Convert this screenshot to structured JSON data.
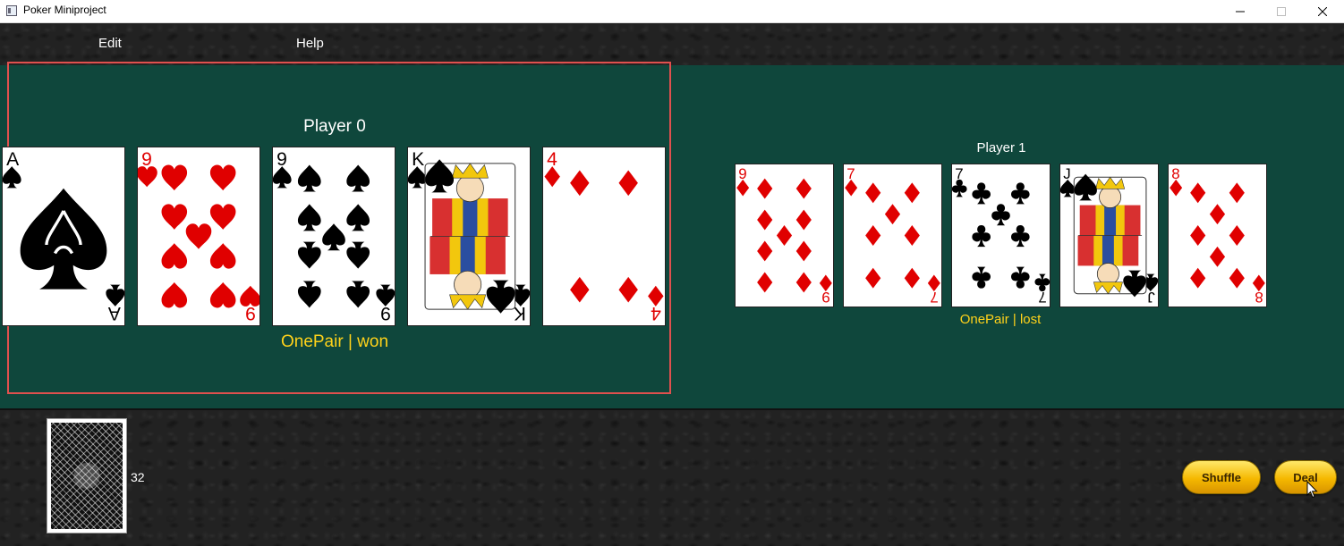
{
  "window": {
    "title": "Poker Miniproject"
  },
  "menu": {
    "items": [
      "Edit",
      "Help"
    ]
  },
  "players": [
    {
      "label": "Player 0",
      "result": "OnePair | won",
      "cards": [
        {
          "rank": "A",
          "suit": "spade"
        },
        {
          "rank": "9",
          "suit": "heart"
        },
        {
          "rank": "9",
          "suit": "spade"
        },
        {
          "rank": "K",
          "suit": "spade"
        },
        {
          "rank": "4",
          "suit": "diamond"
        }
      ]
    },
    {
      "label": "Player 1",
      "result": "OnePair | lost",
      "cards": [
        {
          "rank": "9",
          "suit": "diamond"
        },
        {
          "rank": "7",
          "suit": "diamond"
        },
        {
          "rank": "7",
          "suit": "club"
        },
        {
          "rank": "J",
          "suit": "spade"
        },
        {
          "rank": "8",
          "suit": "diamond"
        }
      ]
    }
  ],
  "deck": {
    "count": "32"
  },
  "buttons": {
    "shuffle": "Shuffle",
    "deal": "Deal"
  },
  "colors": {
    "table": "#0f473c",
    "result_text": "#ffd21a",
    "selection_border": "#e0504e",
    "button": "#f5b800",
    "red_suit": "#e00000",
    "black_suit": "#000000"
  }
}
